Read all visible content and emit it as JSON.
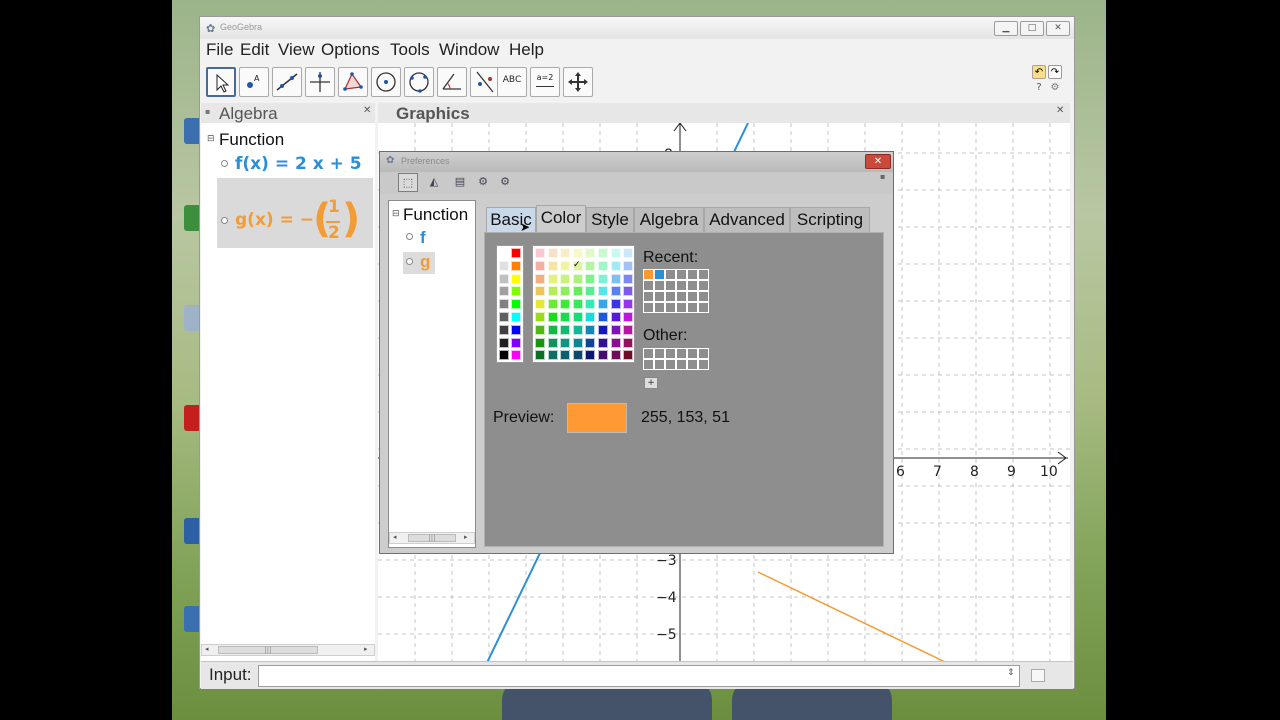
{
  "window": {
    "title": "GeoGebra"
  },
  "menu": [
    "File",
    "Edit",
    "View",
    "Options",
    "Tools",
    "Window",
    "Help"
  ],
  "toolbar": {
    "tools": [
      {
        "name": "move-tool-icon"
      },
      {
        "name": "point-tool-icon"
      },
      {
        "name": "line-tool-icon"
      },
      {
        "name": "perpendicular-line-tool-icon"
      },
      {
        "name": "polygon-tool-icon"
      },
      {
        "name": "circle-tool-icon"
      },
      {
        "name": "circle-through-points-tool-icon"
      },
      {
        "name": "angle-tool-icon"
      },
      {
        "name": "reflect-tool-icon"
      },
      {
        "name": "text-tool-icon",
        "label": "ABC"
      },
      {
        "name": "slider-tool-icon",
        "label": "a=2"
      },
      {
        "name": "move-graphics-view-tool-icon"
      }
    ]
  },
  "algebra": {
    "title": "Algebra",
    "root": "Function",
    "items": [
      {
        "name": "f",
        "expr": "f(x) = 2 x + 5",
        "color": "#2b8fd6"
      },
      {
        "name": "g",
        "expr": "g(x) = −(1/2)",
        "color": "#f39c36"
      }
    ],
    "frac_num": "1",
    "frac_den": "2"
  },
  "graphics": {
    "title": "Graphics",
    "x_ticks": [
      "6",
      "7",
      "8",
      "9",
      "10"
    ],
    "y_ticks": [
      "8",
      "−3",
      "−4",
      "−5"
    ]
  },
  "input": {
    "label": "Input:",
    "value": ""
  },
  "preferences": {
    "title": "Preferences",
    "objects_root": "Function",
    "objects": [
      "f",
      "g"
    ],
    "tabs": [
      "Basic",
      "Color",
      "Style",
      "Algebra",
      "Advanced",
      "Scripting"
    ],
    "selected_tab": "Color",
    "recent_label": "Recent:",
    "other_label": "Other:",
    "preview_label": "Preview:",
    "preview_color": "#ff9933",
    "preview_rgb": "255, 153, 51",
    "recent_colors": [
      "#ff9933",
      "#2b8fd6"
    ]
  },
  "colors": {
    "f_line": "#2b8fd6",
    "g_line": "#f39c36",
    "accent": "#4a6a96"
  }
}
